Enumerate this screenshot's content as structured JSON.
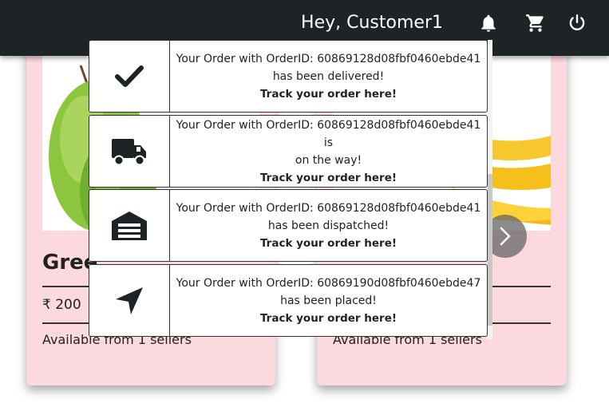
{
  "header": {
    "greeting": "Hey, Customer1",
    "icons": [
      "bell-icon",
      "cart-icon",
      "power-icon"
    ]
  },
  "products": [
    {
      "name_visible": "Gree",
      "price": "₹ 200",
      "availability": "Available from 1 sellers",
      "image": "green-apple"
    },
    {
      "price": "",
      "availability": "Available from 1 sellers",
      "image": "bananas"
    }
  ],
  "notifications": [
    {
      "icon": "check-icon",
      "line1": "Your Order with OrderID: 60869128d08fbf0460ebde41",
      "line2": "has been delivered!",
      "link": "Track your order here!"
    },
    {
      "icon": "truck-icon",
      "line1": "Your Order with OrderID: 60869128d08fbf0460ebde41 is",
      "line2": "on the way!",
      "link": "Track your order here!"
    },
    {
      "icon": "warehouse-icon",
      "line1": "Your Order with OrderID: 60869128d08fbf0460ebde41",
      "line2": "has been dispatched!",
      "link": "Track your order here!"
    },
    {
      "icon": "location-arrow-icon",
      "line1": "Your Order with OrderID: 60869190d08fbf0460ebde47",
      "line2": "has been placed!",
      "link": "Track your order here!"
    }
  ],
  "colors": {
    "header_bg": "#1e2326",
    "card_bg": "#fbd9df",
    "icon_dark": "#1e2326"
  }
}
